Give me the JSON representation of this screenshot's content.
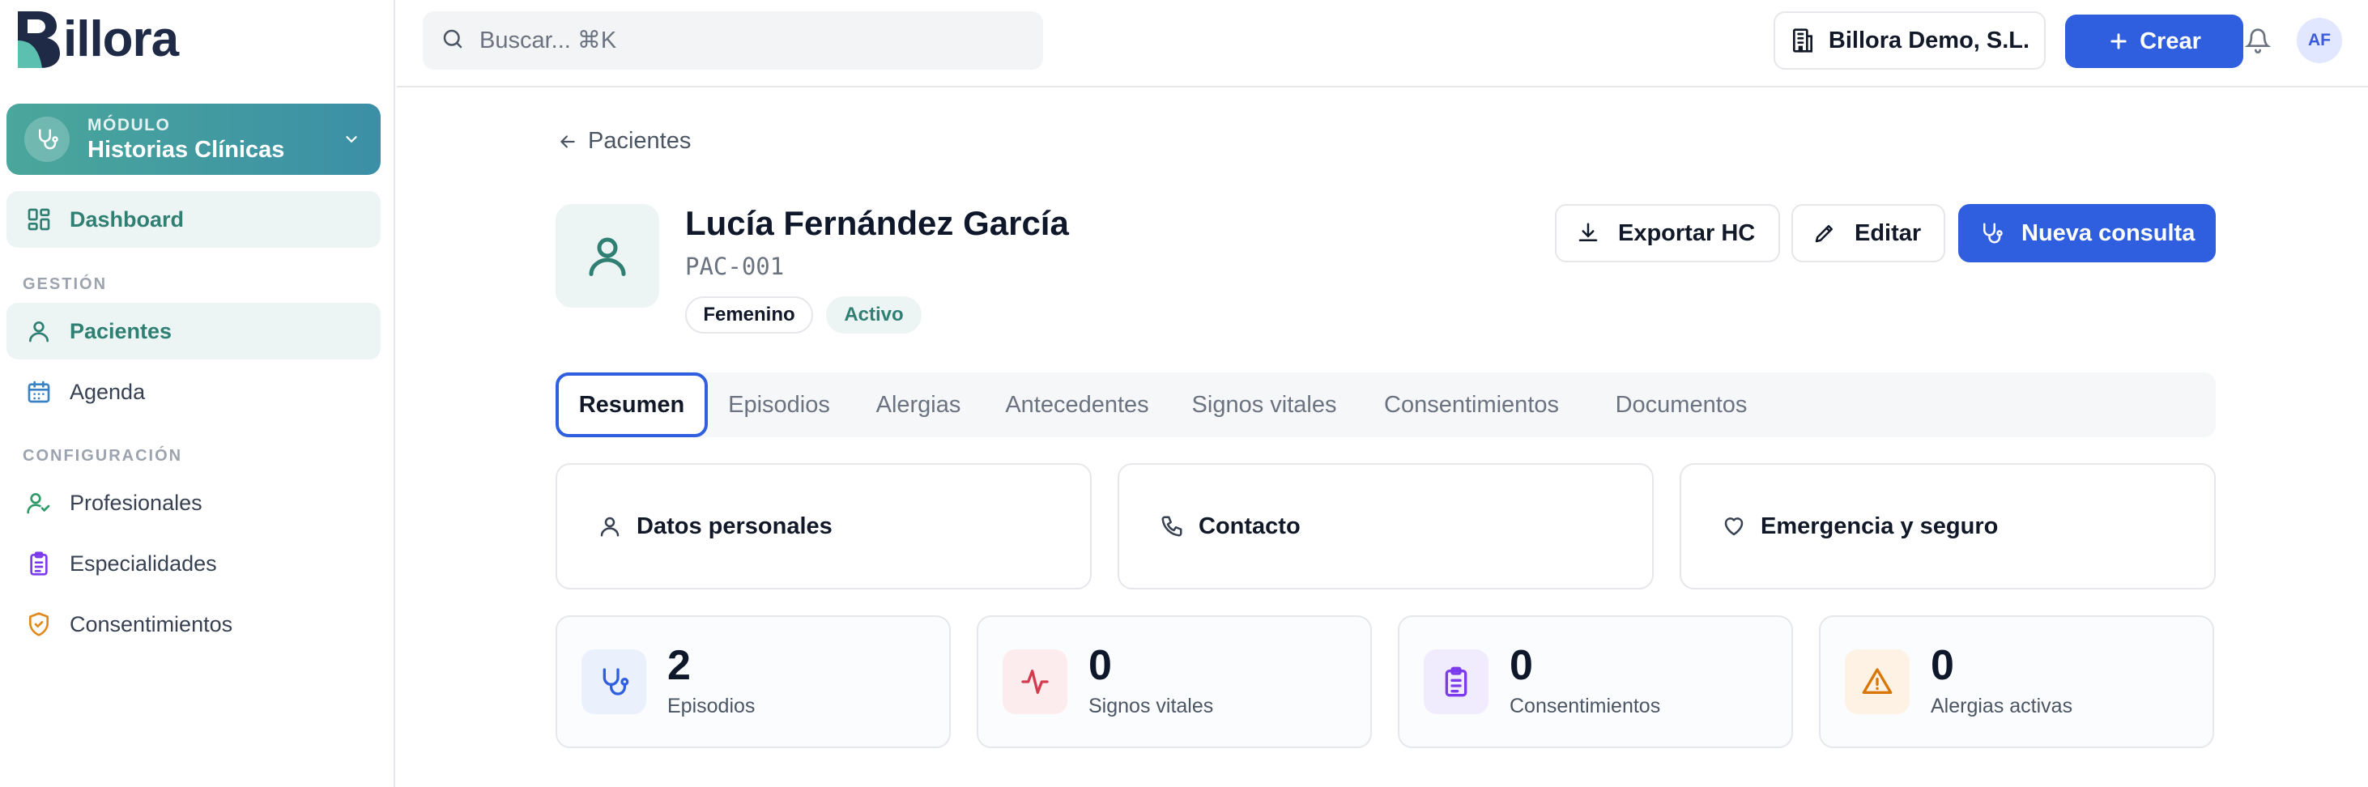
{
  "app": {
    "logo_text": "illora",
    "logo_letter": "B"
  },
  "sidebar": {
    "module": {
      "kicker": "MÓDULO",
      "name": "Historias Clínicas"
    },
    "dashboard_label": "Dashboard",
    "section_gestion": "GESTIÓN",
    "section_config": "CONFIGURACIÓN",
    "items": [
      {
        "label": "Pacientes",
        "icon": "user-icon",
        "active": true
      },
      {
        "label": "Agenda",
        "icon": "calendar-icon"
      },
      {
        "label": "Profesionales",
        "icon": "user-check-icon"
      },
      {
        "label": "Especialidades",
        "icon": "clipboard-icon"
      },
      {
        "label": "Consentimientos",
        "icon": "shield-check-icon"
      }
    ]
  },
  "topbar": {
    "search_placeholder": "Buscar... ⌘K",
    "company": "Billora Demo, S.L.",
    "create_label": "Crear",
    "avatar_initials": "AF"
  },
  "breadcrumb": {
    "back_label": "Pacientes"
  },
  "patient": {
    "name": "Lucía Fernández García",
    "code": "PAC-001",
    "gender": "Femenino",
    "status": "Activo"
  },
  "actions": {
    "export": "Exportar HC",
    "edit": "Editar",
    "new_consult": "Nueva consulta"
  },
  "tabs": [
    "Resumen",
    "Episodios",
    "Alergias",
    "Antecedentes",
    "Signos vitales",
    "Consentimientos",
    "Documentos"
  ],
  "info_cards": [
    {
      "title": "Datos personales",
      "icon": "user-icon"
    },
    {
      "title": "Contacto",
      "icon": "phone-icon"
    },
    {
      "title": "Emergencia y seguro",
      "icon": "heart-icon"
    }
  ],
  "stats": [
    {
      "value": "2",
      "label": "Episodios",
      "icon": "stethoscope-icon",
      "color": "#2f5fdf",
      "bg": "#eaf0fc"
    },
    {
      "value": "0",
      "label": "Signos vitales",
      "icon": "activity-icon",
      "color": "#d33b4e",
      "bg": "#fcecee"
    },
    {
      "value": "0",
      "label": "Consentimientos",
      "icon": "clipboard-icon",
      "color": "#7c3aed",
      "bg": "#f1ecfd"
    },
    {
      "value": "0",
      "label": "Alergias activas",
      "icon": "alert-triangle-icon",
      "color": "#d97706",
      "bg": "#fdf2e4"
    }
  ],
  "colors": {
    "accent_teal": "#2f7f73",
    "primary_blue": "#2f5fdf",
    "module_gradient_start": "#4aa79b",
    "module_gradient_end": "#3c8fa6"
  }
}
